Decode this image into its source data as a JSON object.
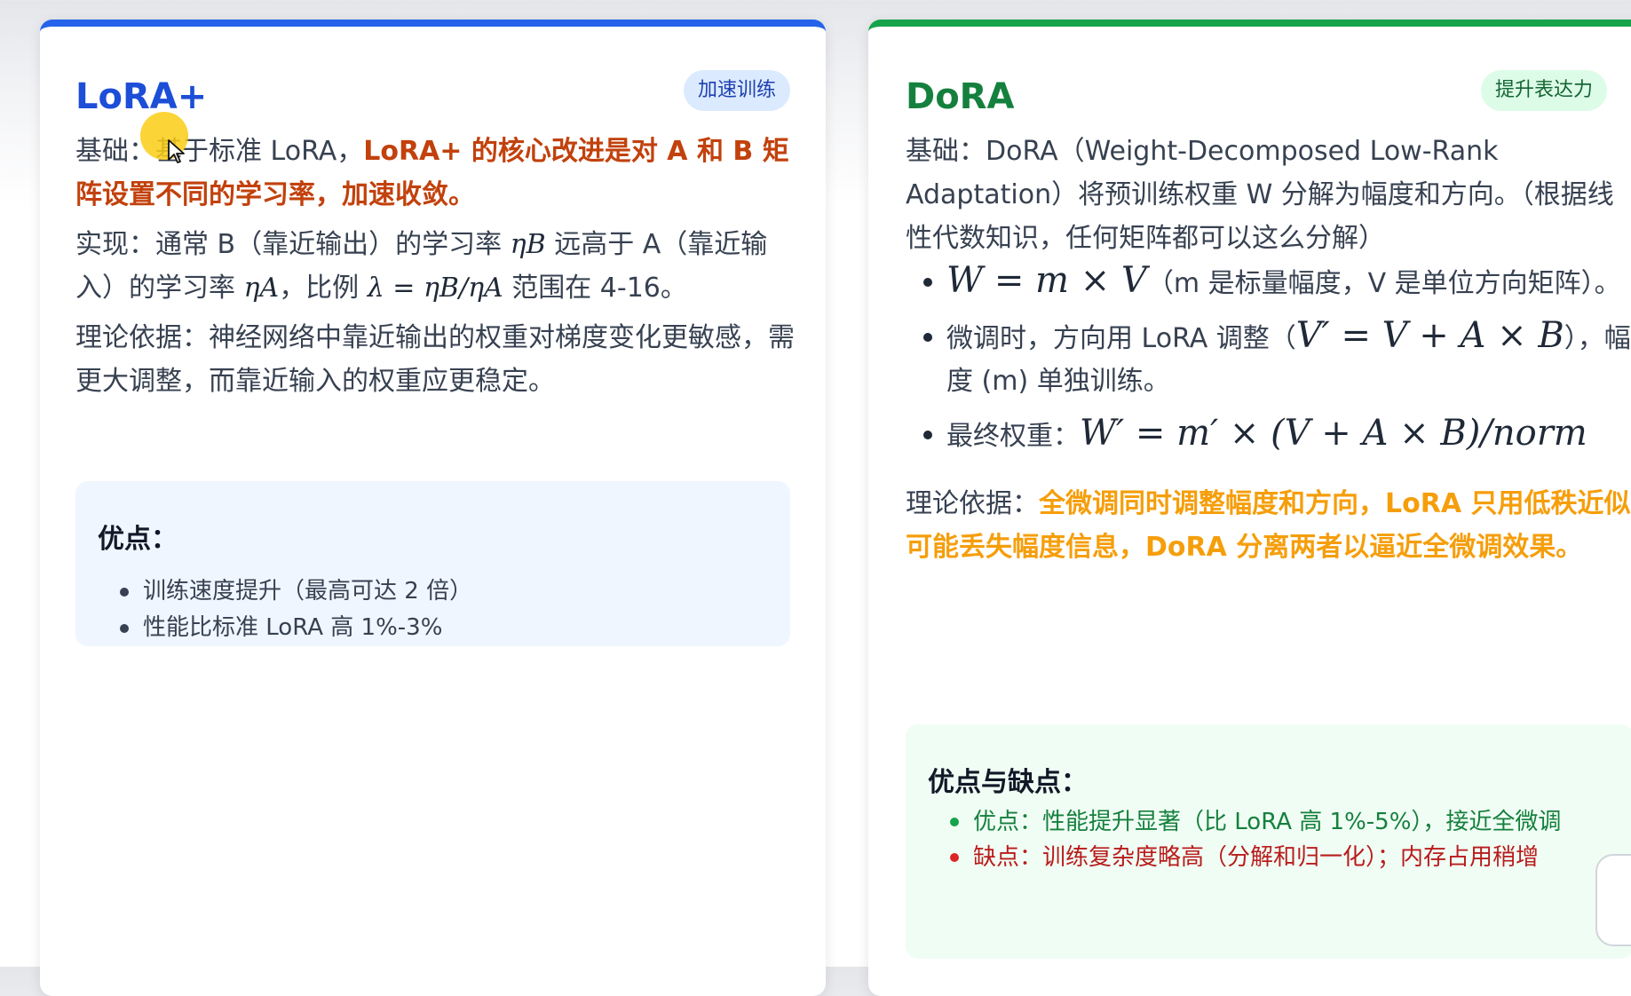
{
  "lora_plus": {
    "title": "LoRA+",
    "badge": "加速训练",
    "basis_label": "基础：",
    "basis_text": "基于标准 LoRA，",
    "basis_highlight": "LoRA+ 的核心改进是对 A 和 B 矩阵设置不同的学习率，加速收敛。",
    "impl_label": "实现：",
    "impl_text_1": "通常 B（靠近输出）的学习率 ",
    "impl_math_1": "ηB",
    "impl_text_2": " 远高于 A（靠近输入）的学习率 ",
    "impl_math_2": "ηA",
    "impl_text_3": "，比例 ",
    "impl_math_3": "λ = ηB/ηA",
    "impl_text_4": " 范围在 4-16。",
    "theory_label": "理论依据：",
    "theory_text": "神经网络中靠近输出的权重对梯度变化更敏感，需更大调整，而靠近输入的权重应更稳定。",
    "advantages": {
      "title": "优点：",
      "items": [
        "训练速度提升（最高可达 2 倍）",
        "性能比标准 LoRA 高 1%-3%"
      ]
    }
  },
  "dora": {
    "title": "DoRA",
    "badge": "提升表达力",
    "basis_label": "基础：",
    "basis_text": "DoRA（Weight-Decomposed Low-Rank Adaptation）将预训练权重 W 分解为幅度和方向。（根据线性代数知识，任何矩阵都可以这么分解）",
    "bullet_1_math": "W = m × V",
    "bullet_1_text": "（m 是标量幅度，V 是单位方向矩阵）。",
    "bullet_2_text_1": "微调时，方向用 LoRA 调整（",
    "bullet_2_math": "V′ = V + A × B",
    "bullet_2_text_2": "），幅度 (m) 单独训练。",
    "bullet_3_text": "最终权重：",
    "bullet_3_math": "W′ = m′ × (V + A × B)/norm",
    "theory_label": "理论依据：",
    "theory_highlight": "全微调同时调整幅度和方向，LoRA 只用低秩近似可能丢失幅度信息，DoRA 分离两者以逼近全微调效果。",
    "pros_cons": {
      "title": "优点与缺点：",
      "pro": "优点：性能提升显著（比 LoRA 高 1%-5%），接近全微调",
      "con": "缺点：训练复杂度略高（分解和归一化）；内存占用稍增"
    }
  },
  "colors": {
    "lora_accent": "#2563eb",
    "dora_accent": "#16a34a",
    "lora_highlight": "#c2410c",
    "dora_highlight": "#f59e0b",
    "pro_color": "#15803d",
    "con_color": "#b91c1c",
    "cursor_highlight": "#facc15"
  }
}
